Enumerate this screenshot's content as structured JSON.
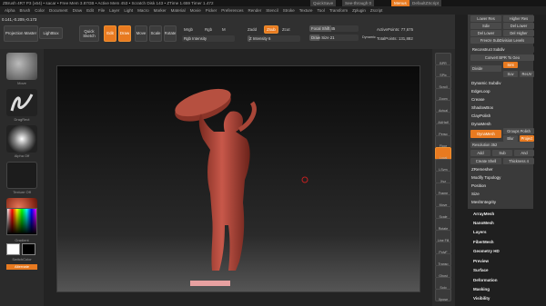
{
  "title_bar": {
    "text": "ZBrush 4R7 P3 (x64) • sacar • Free Mem 3.87GB • Active Mem 453 • Scratch Disk 143 • ZTime 1.659 Timer 1.472",
    "quicksave": "QuickSave",
    "see_through": "See-through 0",
    "menus": "Menus",
    "default_zscript": "DefaultZScript"
  },
  "menu_bar": [
    "Alpha",
    "Brush",
    "Color",
    "Document",
    "Draw",
    "Edit",
    "File",
    "Layer",
    "Light",
    "Macro",
    "Marker",
    "Material",
    "Movie",
    "Picker",
    "Preferences",
    "Render",
    "Stencil",
    "Stroke",
    "Texture",
    "Tool",
    "Transform",
    "Zplugin",
    "Zscript"
  ],
  "coords": "0.141,-0.209,-0.173",
  "toolbar": {
    "projection_master": "Projection Master",
    "lightbox": "LightBox",
    "quick_sketch": "Quick Sketch",
    "edit": "Edit",
    "draw": "Draw",
    "move": "Move",
    "scale": "Scale",
    "rotate": "Rotate",
    "mrgb": "Mrgb",
    "rgb": "Rgb",
    "m": "M",
    "zadd": "Zadd",
    "zsub": "Zsub",
    "zcut": "Zcut",
    "rgb_intensity": "Rgb Intensity",
    "z_intensity_label": "Z Intensity",
    "z_intensity_value": "6",
    "focal_shift_label": "Focal Shift",
    "focal_shift_value": "45",
    "draw_size_label": "Draw Size",
    "draw_size_value": "21",
    "dynamic": "Dynamic",
    "active_points": "ActivePoints: 77,675",
    "total_points": "TotalPoints: 131,882"
  },
  "left_shelf": {
    "brush_label": "Move",
    "stroke_label": "DragRect",
    "alpha_label": "Alpha Off",
    "texture_label": "Texture Off",
    "material_label": "MatCap Red",
    "gradient": "Gradient",
    "switch_color": "SwitchColor",
    "alternate": "Alternate"
  },
  "right_shelf": [
    "BPR",
    "SPix",
    "Scroll",
    "Zoom",
    "Actual",
    "AAHalf",
    "Persp",
    "Floor",
    "Local",
    "LSym",
    "Xyz",
    "Frame",
    "Move",
    "Scale",
    "Rotate",
    "Line Fill",
    "PolyF",
    "Transp",
    "Ghost",
    "Solo",
    "Xpose"
  ],
  "subtool_panel": {
    "buttons_top": [
      [
        "Lower Res",
        "Higher Res"
      ],
      [
        "Sdiv",
        "Del Lower"
      ],
      [
        "Del Lower",
        "Del Higher"
      ],
      [
        "Freeze SubDivision Levels"
      ],
      [
        "Reconstruct Subdiv"
      ],
      [
        "Convert BPR To Geo"
      ]
    ],
    "divide": "Divide",
    "smt": "Smt",
    "suv": "Suv",
    "reuv": "ReUV",
    "items": [
      "Dynamic Subdiv",
      "EdgeLoop",
      "Crease",
      "ShadowBox",
      "ClayPolish",
      "DynaMesh"
    ],
    "dynamesh_btn": "DynaMesh",
    "groups": "Groups",
    "polish": "Polish",
    "blur": "Blur",
    "project": "Project",
    "resolution": "Resolution 352",
    "add": "Add",
    "sub": "Sub",
    "and": "And",
    "create_shell": "Create Shell",
    "thickness": "Thickness 4",
    "items2": [
      "ZRemesher",
      "Modify Topology",
      "Position",
      "Size",
      "MeshIntegrity"
    ]
  },
  "lower_palette": [
    "ArrayMesh",
    "NanoMesh",
    "Layers",
    "FiberMesh",
    "Geometry HD",
    "Preview",
    "Surface",
    "Deformation",
    "Masking",
    "Visibility"
  ],
  "colors": {
    "accent": "#e87a20",
    "figure": "#b84a3a",
    "pedestal": "#e8a0a0"
  }
}
